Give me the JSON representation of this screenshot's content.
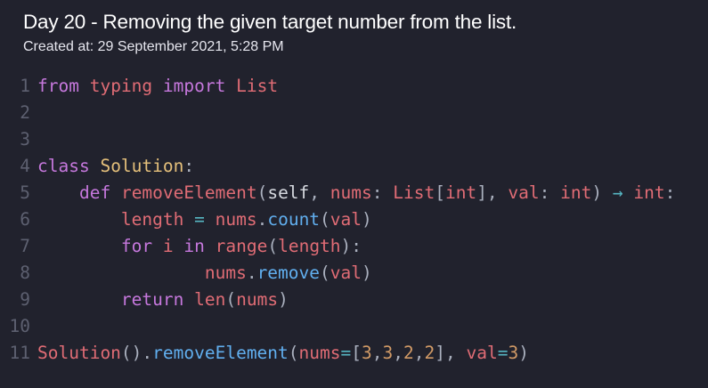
{
  "header": {
    "title": "Day 20 - Removing the given target number from the list.",
    "created": "Created at: 29 September 2021, 5:28 PM"
  },
  "code": {
    "language": "python",
    "lines": [
      {
        "n": "1",
        "indent": "",
        "tokens": [
          {
            "t": "from",
            "c": "kw"
          },
          {
            "t": " ",
            "c": "pl"
          },
          {
            "t": "typing",
            "c": "fn"
          },
          {
            "t": " ",
            "c": "pl"
          },
          {
            "t": "import",
            "c": "kw"
          },
          {
            "t": " ",
            "c": "pl"
          },
          {
            "t": "List",
            "c": "fn"
          }
        ]
      },
      {
        "n": "2",
        "indent": "",
        "tokens": []
      },
      {
        "n": "3",
        "indent": "",
        "tokens": []
      },
      {
        "n": "4",
        "indent": "",
        "tokens": [
          {
            "t": "class",
            "c": "kw"
          },
          {
            "t": " ",
            "c": "pl"
          },
          {
            "t": "Solution",
            "c": "cls"
          },
          {
            "t": ":",
            "c": "pu"
          }
        ]
      },
      {
        "n": "5",
        "indent": "    ",
        "tokens": [
          {
            "t": "def",
            "c": "kw"
          },
          {
            "t": " ",
            "c": "pl"
          },
          {
            "t": "removeElement",
            "c": "fn"
          },
          {
            "t": "(",
            "c": "pu"
          },
          {
            "t": "self",
            "c": "pl"
          },
          {
            "t": ", ",
            "c": "pu"
          },
          {
            "t": "nums",
            "c": "fn"
          },
          {
            "t": ": ",
            "c": "pu"
          },
          {
            "t": "List",
            "c": "fn"
          },
          {
            "t": "[",
            "c": "pu"
          },
          {
            "t": "int",
            "c": "fn"
          },
          {
            "t": "], ",
            "c": "pu"
          },
          {
            "t": "val",
            "c": "fn"
          },
          {
            "t": ": ",
            "c": "pu"
          },
          {
            "t": "int",
            "c": "fn"
          },
          {
            "t": ") ",
            "c": "pu"
          },
          {
            "t": "→",
            "c": "op"
          },
          {
            "t": " ",
            "c": "pl"
          },
          {
            "t": "int",
            "c": "fn"
          },
          {
            "t": ":",
            "c": "pu"
          }
        ]
      },
      {
        "n": "6",
        "indent": "        ",
        "tokens": [
          {
            "t": "length",
            "c": "fn"
          },
          {
            "t": " ",
            "c": "pl"
          },
          {
            "t": "=",
            "c": "op"
          },
          {
            "t": " ",
            "c": "pl"
          },
          {
            "t": "nums",
            "c": "fn"
          },
          {
            "t": ".",
            "c": "pu"
          },
          {
            "t": "count",
            "c": "meth"
          },
          {
            "t": "(",
            "c": "pu"
          },
          {
            "t": "val",
            "c": "fn"
          },
          {
            "t": ")",
            "c": "pu"
          }
        ]
      },
      {
        "n": "7",
        "indent": "        ",
        "tokens": [
          {
            "t": "for",
            "c": "kw"
          },
          {
            "t": " ",
            "c": "pl"
          },
          {
            "t": "i",
            "c": "fn"
          },
          {
            "t": " ",
            "c": "pl"
          },
          {
            "t": "in",
            "c": "kw"
          },
          {
            "t": " ",
            "c": "pl"
          },
          {
            "t": "range",
            "c": "fn"
          },
          {
            "t": "(",
            "c": "pu"
          },
          {
            "t": "length",
            "c": "fn"
          },
          {
            "t": "):",
            "c": "pu"
          }
        ]
      },
      {
        "n": "8",
        "indent": "                ",
        "tokens": [
          {
            "t": "nums",
            "c": "fn"
          },
          {
            "t": ".",
            "c": "pu"
          },
          {
            "t": "remove",
            "c": "meth"
          },
          {
            "t": "(",
            "c": "pu"
          },
          {
            "t": "val",
            "c": "fn"
          },
          {
            "t": ")",
            "c": "pu"
          }
        ]
      },
      {
        "n": "9",
        "indent": "        ",
        "tokens": [
          {
            "t": "return",
            "c": "kw"
          },
          {
            "t": " ",
            "c": "pl"
          },
          {
            "t": "len",
            "c": "fn"
          },
          {
            "t": "(",
            "c": "pu"
          },
          {
            "t": "nums",
            "c": "fn"
          },
          {
            "t": ")",
            "c": "pu"
          }
        ]
      },
      {
        "n": "10",
        "indent": "",
        "tokens": []
      },
      {
        "n": "11",
        "indent": "",
        "tokens": [
          {
            "t": "Solution",
            "c": "fn"
          },
          {
            "t": "().",
            "c": "pu"
          },
          {
            "t": "removeElement",
            "c": "meth"
          },
          {
            "t": "(",
            "c": "pu"
          },
          {
            "t": "nums",
            "c": "fn"
          },
          {
            "t": "=",
            "c": "op"
          },
          {
            "t": "[",
            "c": "pu"
          },
          {
            "t": "3",
            "c": "num"
          },
          {
            "t": ",",
            "c": "pu"
          },
          {
            "t": "3",
            "c": "num"
          },
          {
            "t": ",",
            "c": "pu"
          },
          {
            "t": "2",
            "c": "num"
          },
          {
            "t": ",",
            "c": "pu"
          },
          {
            "t": "2",
            "c": "num"
          },
          {
            "t": "], ",
            "c": "pu"
          },
          {
            "t": "val",
            "c": "fn"
          },
          {
            "t": "=",
            "c": "op"
          },
          {
            "t": "3",
            "c": "num"
          },
          {
            "t": ")",
            "c": "pu"
          }
        ]
      }
    ]
  }
}
